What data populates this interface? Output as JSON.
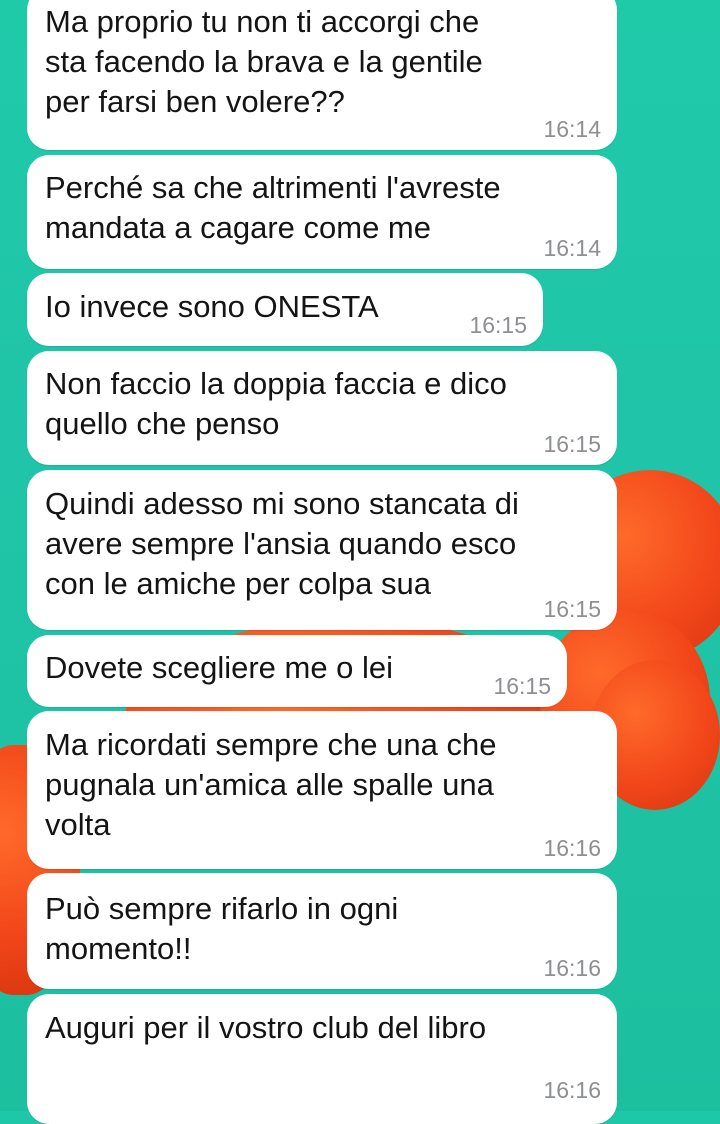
{
  "messages": [
    {
      "text": "Ma proprio tu non ti accorgi che\nsta facendo la brava e la gentile\nper farsi ben volere??",
      "time": "16:14"
    },
    {
      "text": "Perché sa che altrimenti l'avreste\nmandata a cagare come me",
      "time": "16:14"
    },
    {
      "text": "Io invece sono ONESTA",
      "time": "16:15"
    },
    {
      "text": "Non faccio la doppia faccia e dico\nquello che penso",
      "time": "16:15"
    },
    {
      "text": "Quindi adesso mi sono stancata di\navere sempre l'ansia quando esco\ncon le amiche per colpa sua",
      "time": "16:15"
    },
    {
      "text": "Dovete scegliere me o lei",
      "time": "16:15"
    },
    {
      "text": "Ma ricordati sempre che una che\npugnala un'amica alle spalle una\nvolta",
      "time": "16:16"
    },
    {
      "text": "Può sempre rifarlo in ogni\nmomento!!",
      "time": "16:16"
    },
    {
      "text": "Auguri per il vostro club del libro",
      "time": "16:16"
    }
  ],
  "colors": {
    "wallpaper": "#1ec7a8",
    "bubble": "#ffffff",
    "timestamp": "#8d8f92",
    "accent_shape": "#f2471a"
  }
}
